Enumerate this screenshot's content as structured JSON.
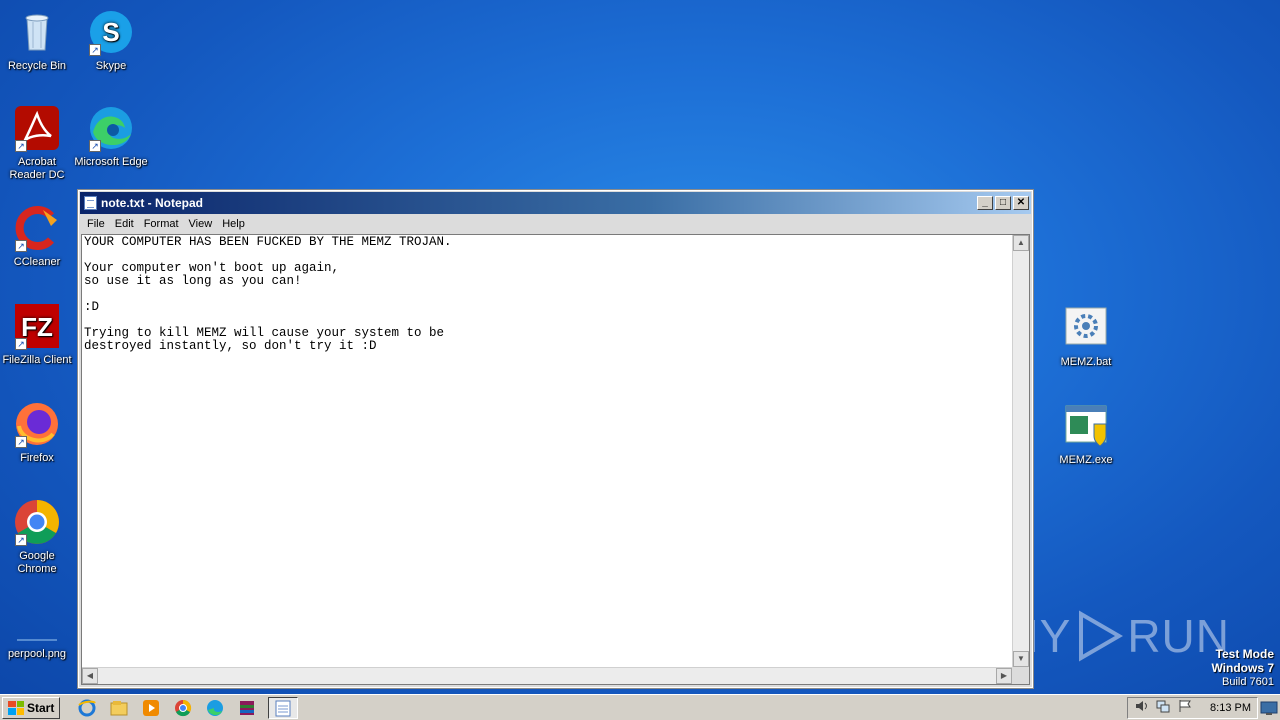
{
  "desktop": {
    "icons_left": [
      {
        "label": "Recycle Bin",
        "icon": "recycle-bin-icon"
      },
      {
        "label": "Acrobat Reader DC",
        "icon": "acrobat-icon"
      },
      {
        "label": "CCleaner",
        "icon": "ccleaner-icon"
      },
      {
        "label": "FileZilla Client",
        "icon": "filezilla-icon"
      },
      {
        "label": "Firefox",
        "icon": "firefox-icon"
      },
      {
        "label": "Google Chrome",
        "icon": "chrome-icon"
      },
      {
        "label": "perpool.png",
        "icon": "image-file-icon"
      }
    ],
    "icons_col2": [
      {
        "label": "Skype",
        "icon": "skype-icon"
      },
      {
        "label": "Microsoft Edge",
        "icon": "edge-icon"
      }
    ],
    "icons_right": [
      {
        "label": "MEMZ.bat",
        "icon": "batch-file-icon"
      },
      {
        "label": "MEMZ.exe",
        "icon": "exe-file-icon"
      }
    ]
  },
  "notepad": {
    "title": "note.txt - Notepad",
    "menu": [
      "File",
      "Edit",
      "Format",
      "View",
      "Help"
    ],
    "content": "YOUR COMPUTER HAS BEEN FUCKED BY THE MEMZ TROJAN.\n\nYour computer won't boot up again,\nso use it as long as you can!\n\n:D\n\nTrying to kill MEMZ will cause your system to be\ndestroyed instantly, so don't try it :D",
    "buttons": {
      "minimize": "_",
      "maximize": "□",
      "close": "✕"
    }
  },
  "taskbar": {
    "start_label": "Start",
    "pinned": [
      "ie-icon",
      "explorer-icon",
      "media-player-icon",
      "chrome-icon",
      "edge-icon",
      "winrar-icon",
      "notepad-icon"
    ],
    "clock": "8:13 PM"
  },
  "watermark": {
    "text_left": "ANY",
    "text_right": "RUN"
  },
  "testmode": {
    "line1": "Test Mode",
    "line2": "Windows 7",
    "line3": "Build 7601"
  },
  "colors": {
    "desktop_blue": "#1d6fd6",
    "title_blue": "#0a246a"
  }
}
